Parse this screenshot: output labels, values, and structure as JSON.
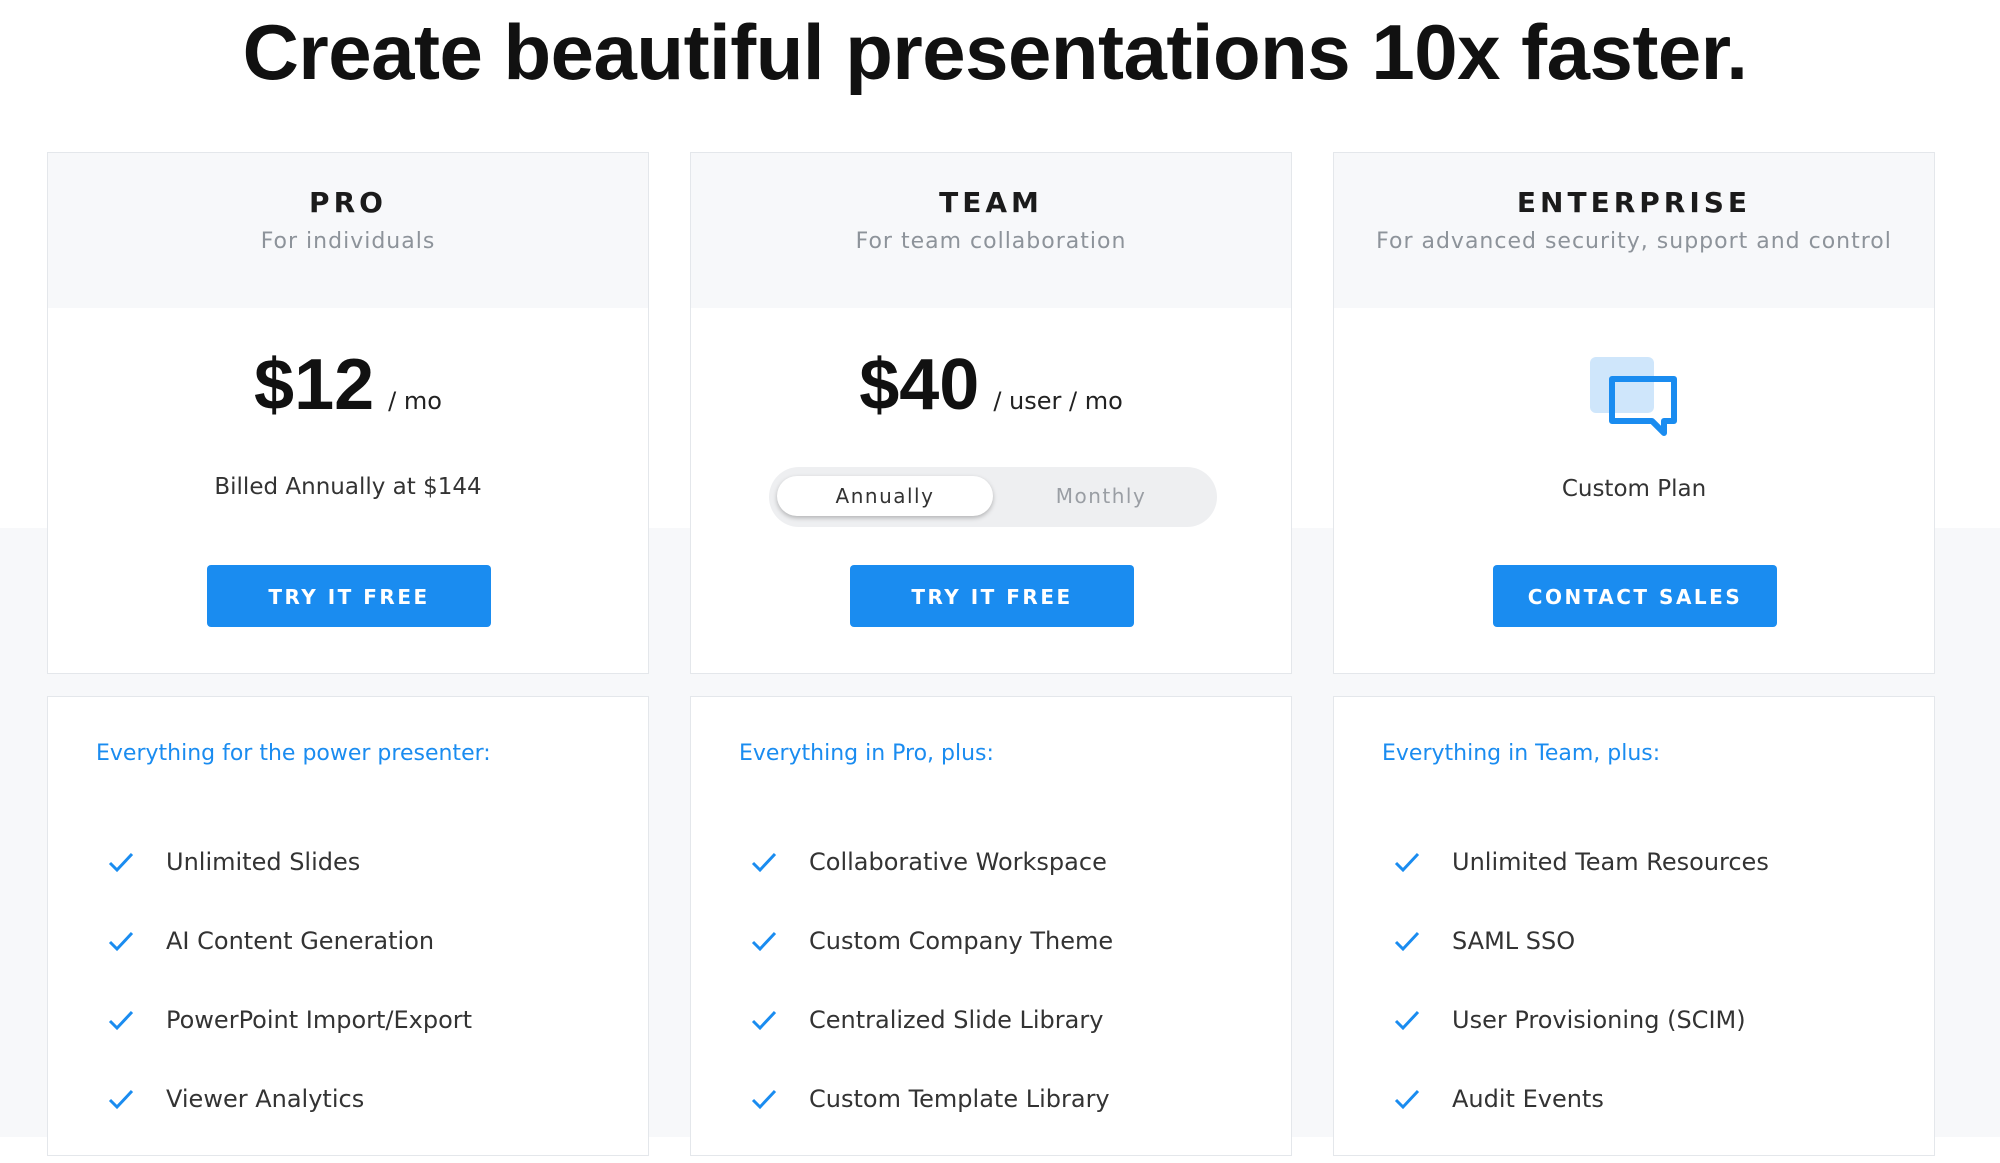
{
  "headline": "Create beautiful presentations 10x faster.",
  "colors": {
    "accent": "#1a8cf0",
    "card_header_bg": "#f7f8fa",
    "page_bottom_bg": "#f7f8fa"
  },
  "plans": [
    {
      "name": "PRO",
      "subtitle": "For individuals",
      "price": "$12",
      "per": "/ mo",
      "billing_note": "Billed Annually at $144",
      "cta_label": "TRY IT FREE",
      "features_title": "Everything for the power presenter:",
      "features": [
        "Unlimited Slides",
        "AI Content Generation",
        "PowerPoint Import/Export",
        "Viewer Analytics"
      ]
    },
    {
      "name": "TEAM",
      "subtitle": "For team collaboration",
      "price": "$40",
      "per": "/ user / mo",
      "billing_toggle": {
        "options": [
          "Annually",
          "Monthly"
        ],
        "selected": "Annually"
      },
      "cta_label": "TRY IT FREE",
      "features_title": "Everything in Pro, plus:",
      "features": [
        "Collaborative Workspace",
        "Custom Company Theme",
        "Centralized Slide Library",
        "Custom Template Library"
      ]
    },
    {
      "name": "ENTERPRISE",
      "subtitle": "For advanced security, support and control",
      "icon": "chat-bubble-icon",
      "custom_plan_label": "Custom Plan",
      "cta_label": "CONTACT SALES",
      "features_title": "Everything in Team, plus:",
      "features": [
        "Unlimited Team Resources",
        "SAML SSO",
        "User Provisioning (SCIM)",
        "Audit Events"
      ]
    }
  ]
}
